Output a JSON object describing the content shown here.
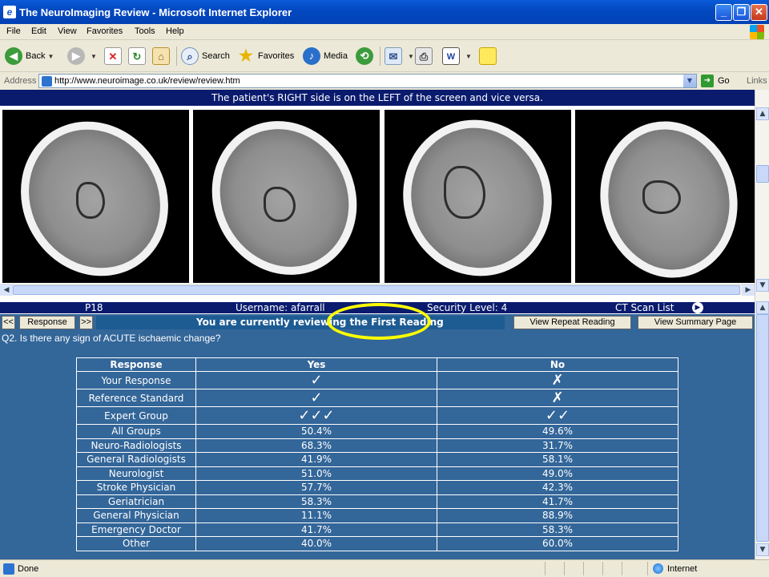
{
  "window": {
    "title": "The NeuroImaging Review - Microsoft Internet Explorer",
    "controls": [
      "minimize",
      "maximize",
      "close"
    ]
  },
  "menu": [
    "File",
    "Edit",
    "View",
    "Favorites",
    "Tools",
    "Help"
  ],
  "toolbar": {
    "back_label": "Back",
    "search_label": "Search",
    "favorites_label": "Favorites",
    "media_label": "Media"
  },
  "address": {
    "label": "Address",
    "url": "http://www.neuroimage.co.uk/review/review.htm",
    "go_label": "Go",
    "links_label": "Links"
  },
  "page": {
    "notice": "The patient's RIGHT side is on the LEFT of the screen and vice versa.",
    "info": {
      "case_id": "P18",
      "username": "Username:  afarrall",
      "security": "Security Level: 4",
      "ct_scan_list": "CT Scan List"
    },
    "nav": {
      "prev": "<<",
      "response": "Response",
      "next": ">>",
      "reviewing": "You are currently reviewing the First Reading",
      "view_repeat": "View Repeat Reading",
      "view_summary": "View Summary Page"
    },
    "question": "Q2. Is there any sign of ACUTE ischaemic change?",
    "table": {
      "headers": [
        "Response",
        "Yes",
        "No"
      ],
      "mark_rows": [
        {
          "label": "Your Response",
          "yes": "✓",
          "no": "✗"
        },
        {
          "label": "Reference Standard",
          "yes": "✓",
          "no": "✗"
        },
        {
          "label": "Expert Group",
          "yes": "✓✓✓",
          "no": "✓✓"
        }
      ],
      "rows": [
        {
          "label": "All Groups",
          "yes": "50.4%",
          "no": "49.6%"
        },
        {
          "label": "Neuro-Radiologists",
          "yes": "68.3%",
          "no": "31.7%"
        },
        {
          "label": "General Radiologists",
          "yes": "41.9%",
          "no": "58.1%"
        },
        {
          "label": "Neurologist",
          "yes": "51.0%",
          "no": "49.0%"
        },
        {
          "label": "Stroke Physician",
          "yes": "57.7%",
          "no": "42.3%"
        },
        {
          "label": "Geriatrician",
          "yes": "58.3%",
          "no": "41.7%"
        },
        {
          "label": "General Physician",
          "yes": "11.1%",
          "no": "88.9%"
        },
        {
          "label": "Emergency Doctor",
          "yes": "41.7%",
          "no": "58.3%"
        },
        {
          "label": "Other",
          "yes": "40.0%",
          "no": "60.0%"
        }
      ]
    }
  },
  "status": {
    "text": "Done",
    "zone": "Internet"
  },
  "colors": {
    "title_blue": "#0349c2",
    "notice_bar": "#0a1b6e",
    "review_area": "#336699",
    "highlight": "#ffff00"
  },
  "icons": {
    "back": "back-arrow-icon",
    "forward": "forward-arrow-icon",
    "stop": "stop-icon",
    "refresh": "refresh-icon",
    "home": "home-icon",
    "search": "search-icon",
    "favorites": "favorites-star-icon",
    "media": "media-icon",
    "history": "history-icon",
    "mail": "mail-icon",
    "print": "print-icon",
    "edit": "word-edit-icon",
    "discuss": "discuss-icon"
  }
}
